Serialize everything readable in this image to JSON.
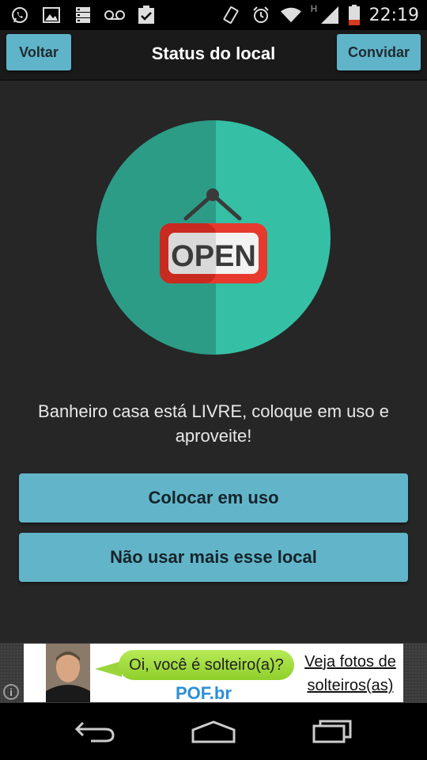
{
  "status_bar": {
    "time": "22:19",
    "network_type": "H",
    "left_icons": [
      "whatsapp-icon",
      "image-icon",
      "storage-icon",
      "voicemail-icon",
      "clipboard-check-icon"
    ],
    "right_icons": [
      "vibrate-icon",
      "alarm-icon",
      "wifi-icon",
      "signal-icon",
      "battery-icon"
    ]
  },
  "action_bar": {
    "back_label": "Voltar",
    "title": "Status do local",
    "invite_label": "Convidar"
  },
  "illustration": {
    "sign_text": "OPEN",
    "circle_colors": [
      "#2c9c87",
      "#35c0a5"
    ],
    "sign_color": "#d22020"
  },
  "message": "Banheiro casa está LIVRE, coloque em uso e aproveite!",
  "buttons": {
    "use_label": "Colocar em uso",
    "remove_label": "Não usar mais esse local"
  },
  "ad": {
    "bubble_text": "Oi, você é solteiro(a)?",
    "brand": "POF.br",
    "cta_line1": "Veja fotos de",
    "cta_line2": "solteiros(as)",
    "info_glyph": "i"
  },
  "nav_bar": {
    "buttons": [
      "back-nav-icon",
      "home-nav-icon",
      "recent-apps-icon"
    ]
  },
  "colors": {
    "accent": "#5fb4c9",
    "background": "#262626"
  }
}
